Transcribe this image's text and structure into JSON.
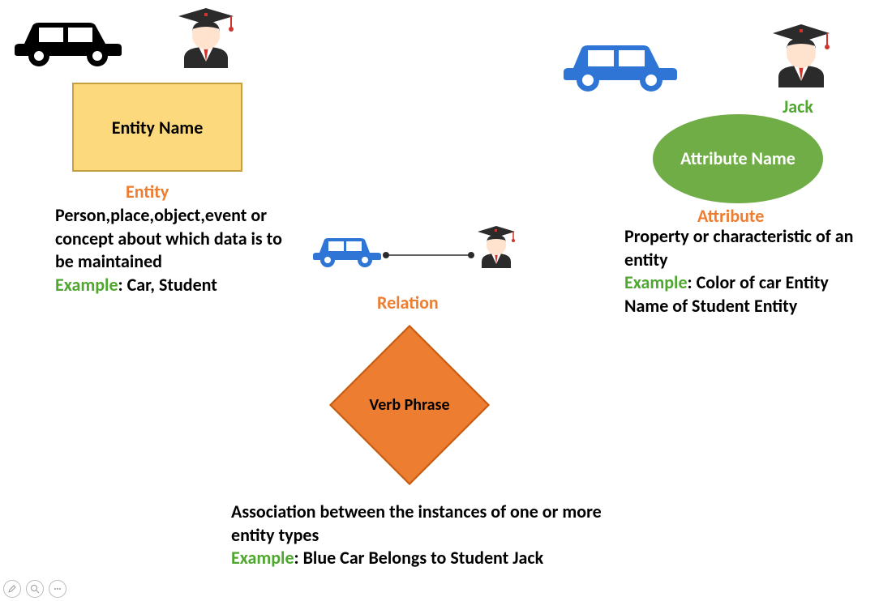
{
  "entity": {
    "shape_label": "Entity Name",
    "title": "Entity",
    "desc": "Person,place,object,event or concept about which data is to be maintained",
    "example_label": "Example",
    "example_text": ": Car, Student"
  },
  "attribute": {
    "shape_label": "Attribute Name",
    "jack": "Jack",
    "title": "Attribute",
    "desc": "Property or characteristic of an entity",
    "example_label": "Example",
    "example_text": ": Color of car Entity Name of Student Entity"
  },
  "relation": {
    "shape_label": "Verb Phrase",
    "title": "Relation",
    "desc": "Association between the instances of one or more entity types",
    "example_label": "Example",
    "example_text": ": Blue Car Belongs to Student Jack"
  }
}
